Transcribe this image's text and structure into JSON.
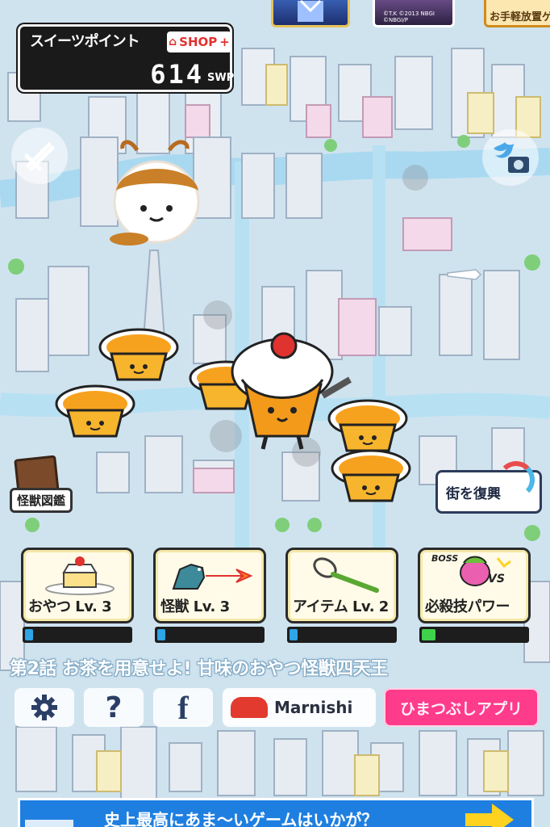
{
  "colors": {
    "sky": "#cfe3ef",
    "river": "#a9d9f0",
    "shop_red": "#e0322f",
    "progress_blue": "#2fa4e6",
    "progress_green": "#3fd24a",
    "himatsubushi_pink": "#ff3b8c",
    "ad_blue": "#1f7fe0"
  },
  "promos": [
    {
      "name": "anime-promo-1",
      "icon": "robot-hero-thumbnail"
    },
    {
      "name": "anime-promo-2",
      "copyright": "©T.K ©2013 NBGI ©NBGI/P"
    },
    {
      "name": "idle-game-promo",
      "label": "お手軽放置ゲ"
    }
  ],
  "points": {
    "title": "スイーツポイント",
    "shop_label": "SHOP",
    "shop_plus": "+",
    "value": "614",
    "unit": "SWP"
  },
  "side_buttons": {
    "sword_icon": "crossed-swords-icon",
    "twitter_icon": "twitter-camera-icon"
  },
  "monster_book": {
    "label": "怪獣図鑑"
  },
  "rebuild": {
    "label": "街を復興"
  },
  "cards": [
    {
      "label": "おやつ Lv.  3",
      "icon": "cake-slice-icon",
      "progress": 0.08,
      "bar_color": "blue"
    },
    {
      "label": "怪獣 Lv.  3",
      "icon": "godzilla-monster-icon",
      "progress": 0.08,
      "bar_color": "blue"
    },
    {
      "label": "アイテム Lv.  2",
      "icon": "whisk-icon",
      "progress": 0.08,
      "bar_color": "blue"
    },
    {
      "label": "必殺技パワー",
      "icon": "boss-vs-icon",
      "boss_tag": "BOSS",
      "vs_tag": "VS",
      "progress": 0.13,
      "bar_color": "green"
    }
  ],
  "episode": "第2話  お茶を用意せよ! 甘味のおやつ怪獣四天王",
  "buttons": {
    "settings_icon": "gear-icon",
    "help_glyph": "?",
    "facebook_glyph": "f",
    "marnishi_label": "Marnishi",
    "himatsubushi_label": "ひまつぶしアプリ"
  },
  "ad": {
    "text": "史上最高にあま〜いゲームはいかが？"
  }
}
